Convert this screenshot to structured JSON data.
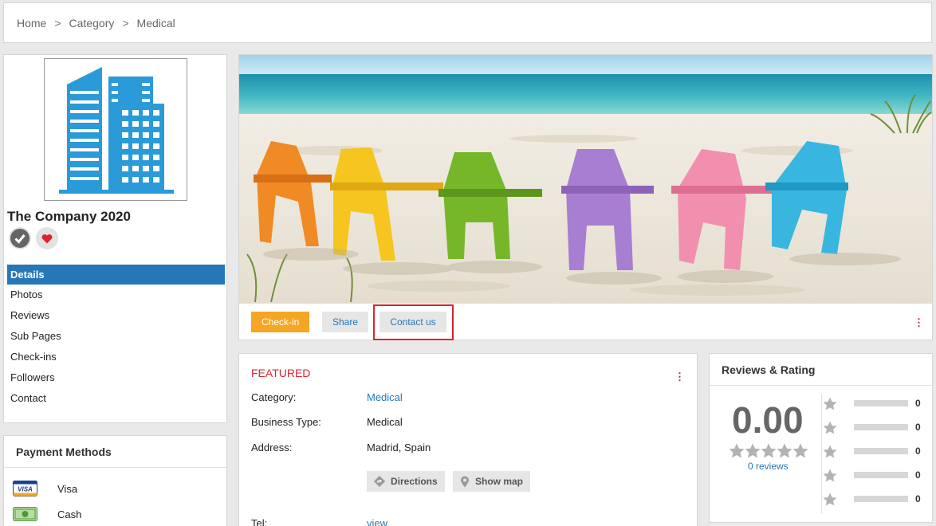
{
  "breadcrumb": {
    "home": "Home",
    "separator": ">",
    "category": "Category",
    "current": "Medical"
  },
  "profile": {
    "company_name": "The Company 2020",
    "logo_icon": "building-icon",
    "nav": [
      "Details",
      "Photos",
      "Reviews",
      "Sub Pages",
      "Check-ins",
      "Followers",
      "Contact"
    ],
    "active_nav": "Details"
  },
  "payment": {
    "title": "Payment Methods",
    "methods": [
      {
        "label": "Visa",
        "icon": "visa-card-icon",
        "badge": "VISA"
      },
      {
        "label": "Cash",
        "icon": "cash-icon"
      }
    ]
  },
  "hero": {
    "image": "beach-chairs-photo",
    "actions": {
      "checkin": "Check-in",
      "share": "Share",
      "contact": "Contact us"
    }
  },
  "details": {
    "featured": "FEATURED",
    "category": {
      "label": "Category:",
      "value": "Medical"
    },
    "business_type": {
      "label": "Business Type:",
      "value": "Medical"
    },
    "address": {
      "label": "Address:",
      "value": "Madrid, Spain"
    },
    "directions": "Directions",
    "show_map": "Show map",
    "tel": {
      "label": "Tel:",
      "value": "view"
    }
  },
  "reviews": {
    "title": "Reviews & Rating",
    "score": "0.00",
    "count_label": "0 reviews",
    "breakdown": [
      0,
      0,
      0,
      0,
      0
    ]
  },
  "colors": {
    "accent": "#2577b8",
    "checkin": "#f5a623",
    "highlight": "#d9262e"
  }
}
